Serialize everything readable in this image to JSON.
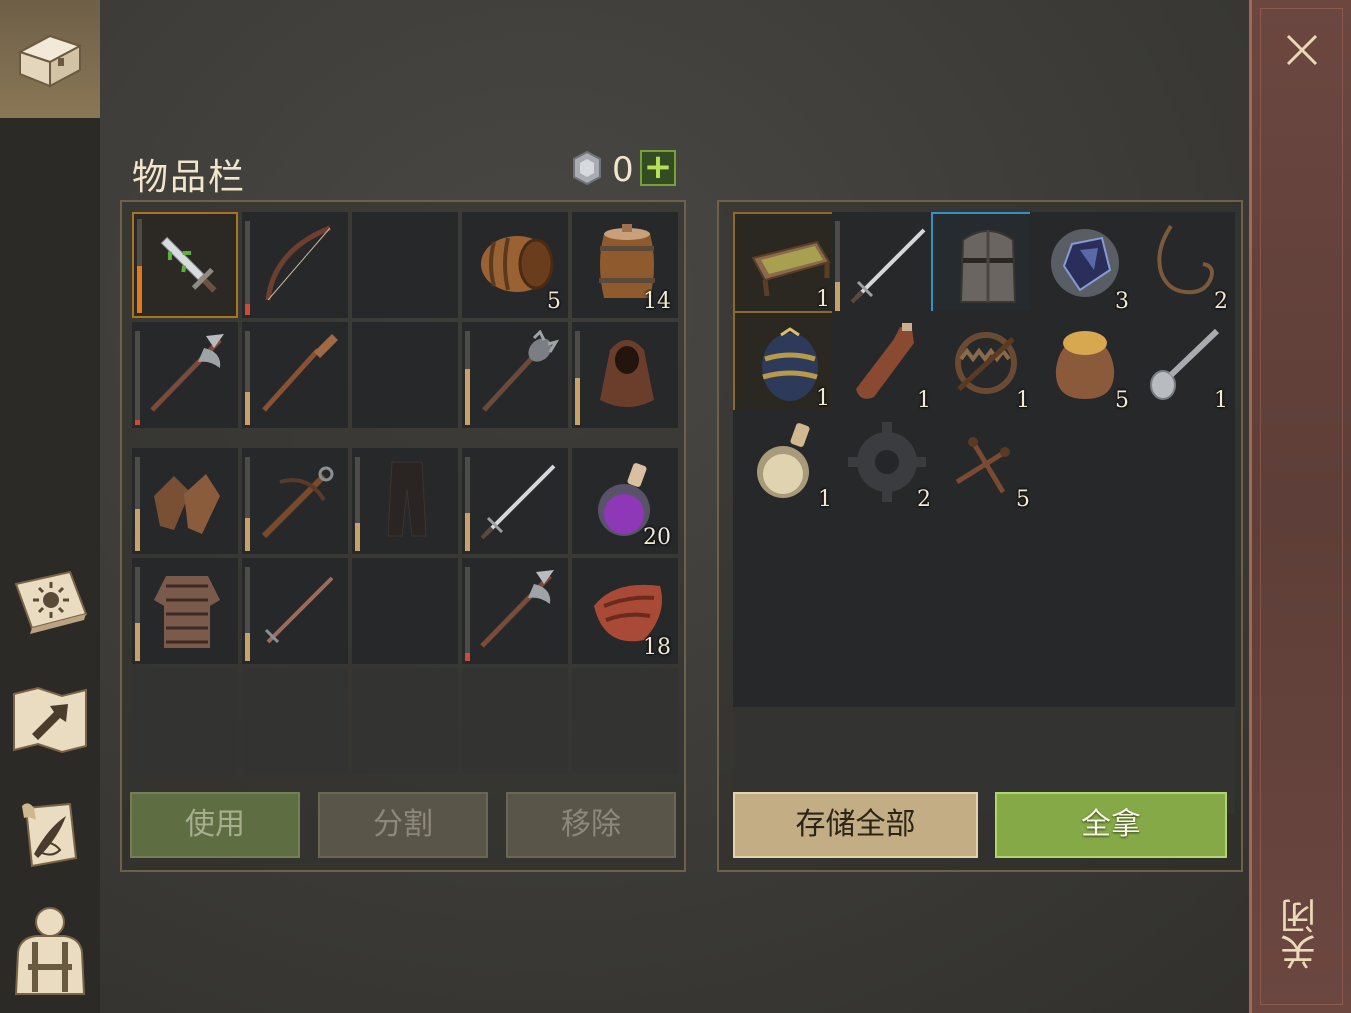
{
  "sidebar": {
    "items": [
      {
        "icon": "chest-icon"
      },
      {
        "icon": "sun-book-icon"
      },
      {
        "icon": "map-arrow-icon"
      },
      {
        "icon": "quill-scroll-icon"
      },
      {
        "icon": "character-icon"
      }
    ]
  },
  "inventory": {
    "title": "物品栏",
    "coins": "0",
    "plus": "+",
    "buttons": {
      "use": "使用",
      "split": "分割",
      "remove": "移除"
    }
  },
  "storage": {
    "buttons": {
      "store_all": "存储全部",
      "take_all": "全拿"
    }
  },
  "close": {
    "label": "关闭"
  },
  "colors": {
    "take_all": "#86a948",
    "store_all": "#c2ad85",
    "close_strip": "#6b4740"
  },
  "inv_slots": [
    {
      "item": "poisoned-dagger",
      "count": "",
      "dur": 0.5,
      "dur_color": "#e07a1c",
      "sel": "orange"
    },
    {
      "item": "longbow",
      "count": "",
      "dur": 0.12,
      "dur_color": "#d04a3a"
    },
    {
      "item": "",
      "count": ""
    },
    {
      "item": "barrel",
      "count": "5"
    },
    {
      "item": "wooden-keg",
      "count": "14"
    },
    {
      "item": "halberd",
      "count": "",
      "dur": 0.05,
      "dur_color": "#d04a3a"
    },
    {
      "item": "wooden-oar",
      "count": "",
      "dur": 0.35,
      "dur_color": "#c9a26a"
    },
    {
      "item": "",
      "count": ""
    },
    {
      "item": "spiked-mace",
      "count": "",
      "dur": 0.6,
      "dur_color": "#c9a26a"
    },
    {
      "item": "hooded-cloak",
      "count": "",
      "dur": 0.5,
      "dur_color": "#c9a26a"
    },
    {
      "item": "leather-gloves",
      "count": "",
      "dur": 0.45,
      "dur_color": "#c9a26a"
    },
    {
      "item": "crossbow",
      "count": "",
      "dur": 0.35,
      "dur_color": "#c9a26a"
    },
    {
      "item": "leather-pants",
      "count": "",
      "dur": 0.3,
      "dur_color": "#c9a26a"
    },
    {
      "item": "longsword",
      "count": "",
      "dur": 0.4,
      "dur_color": "#c9a26a"
    },
    {
      "item": "purple-potion",
      "count": "20"
    },
    {
      "item": "chainmail-shirt",
      "count": "",
      "dur": 0.4,
      "dur_color": "#c9a26a"
    },
    {
      "item": "rusty-sword",
      "count": "",
      "dur": 0.3,
      "dur_color": "#c9a26a"
    },
    {
      "item": "",
      "count": ""
    },
    {
      "item": "halberd",
      "count": "",
      "dur": 0.08,
      "dur_color": "#d04a3a"
    },
    {
      "item": "raw-meat",
      "count": "18"
    },
    {
      "item": "",
      "count": "",
      "faint": true
    },
    {
      "item": "",
      "count": "",
      "faint": true
    },
    {
      "item": "",
      "count": "",
      "faint": true
    },
    {
      "item": "",
      "count": "",
      "faint": true
    },
    {
      "item": "",
      "count": "",
      "faint": true
    }
  ],
  "store_slots": [
    {
      "item": "wooden-tray",
      "count": "1",
      "sel": "gold"
    },
    {
      "item": "longsword",
      "count": "",
      "dur": 0.35,
      "dur_color": "#c9a26a"
    },
    {
      "item": "great-helm",
      "count": "",
      "sel": "blue"
    },
    {
      "item": "dark-crystal",
      "count": "3"
    },
    {
      "item": "rope",
      "count": "2"
    },
    {
      "item": "painted-egg",
      "count": "1",
      "sel": "gold"
    },
    {
      "item": "leather-flask",
      "count": "1"
    },
    {
      "item": "bear-trap",
      "count": "1"
    },
    {
      "item": "grain-sack",
      "count": "5"
    },
    {
      "item": "spoon",
      "count": "1"
    },
    {
      "item": "water-flask",
      "count": "1"
    },
    {
      "item": "gear",
      "count": "2"
    },
    {
      "item": "nails",
      "count": "5"
    },
    {
      "item": "",
      "count": ""
    },
    {
      "item": "",
      "count": ""
    },
    {
      "item": "",
      "count": ""
    },
    {
      "item": "",
      "count": ""
    },
    {
      "item": "",
      "count": ""
    },
    {
      "item": "",
      "count": ""
    },
    {
      "item": "",
      "count": ""
    },
    {
      "item": "",
      "count": ""
    },
    {
      "item": "",
      "count": ""
    },
    {
      "item": "",
      "count": ""
    },
    {
      "item": "",
      "count": ""
    },
    {
      "item": "",
      "count": ""
    },
    {
      "item": "",
      "count": "",
      "faint": true
    },
    {
      "item": "",
      "count": "",
      "faint": true
    },
    {
      "item": "",
      "count": "",
      "faint": true
    },
    {
      "item": "",
      "count": "",
      "faint": true
    },
    {
      "item": "",
      "count": "",
      "faint": true
    }
  ]
}
